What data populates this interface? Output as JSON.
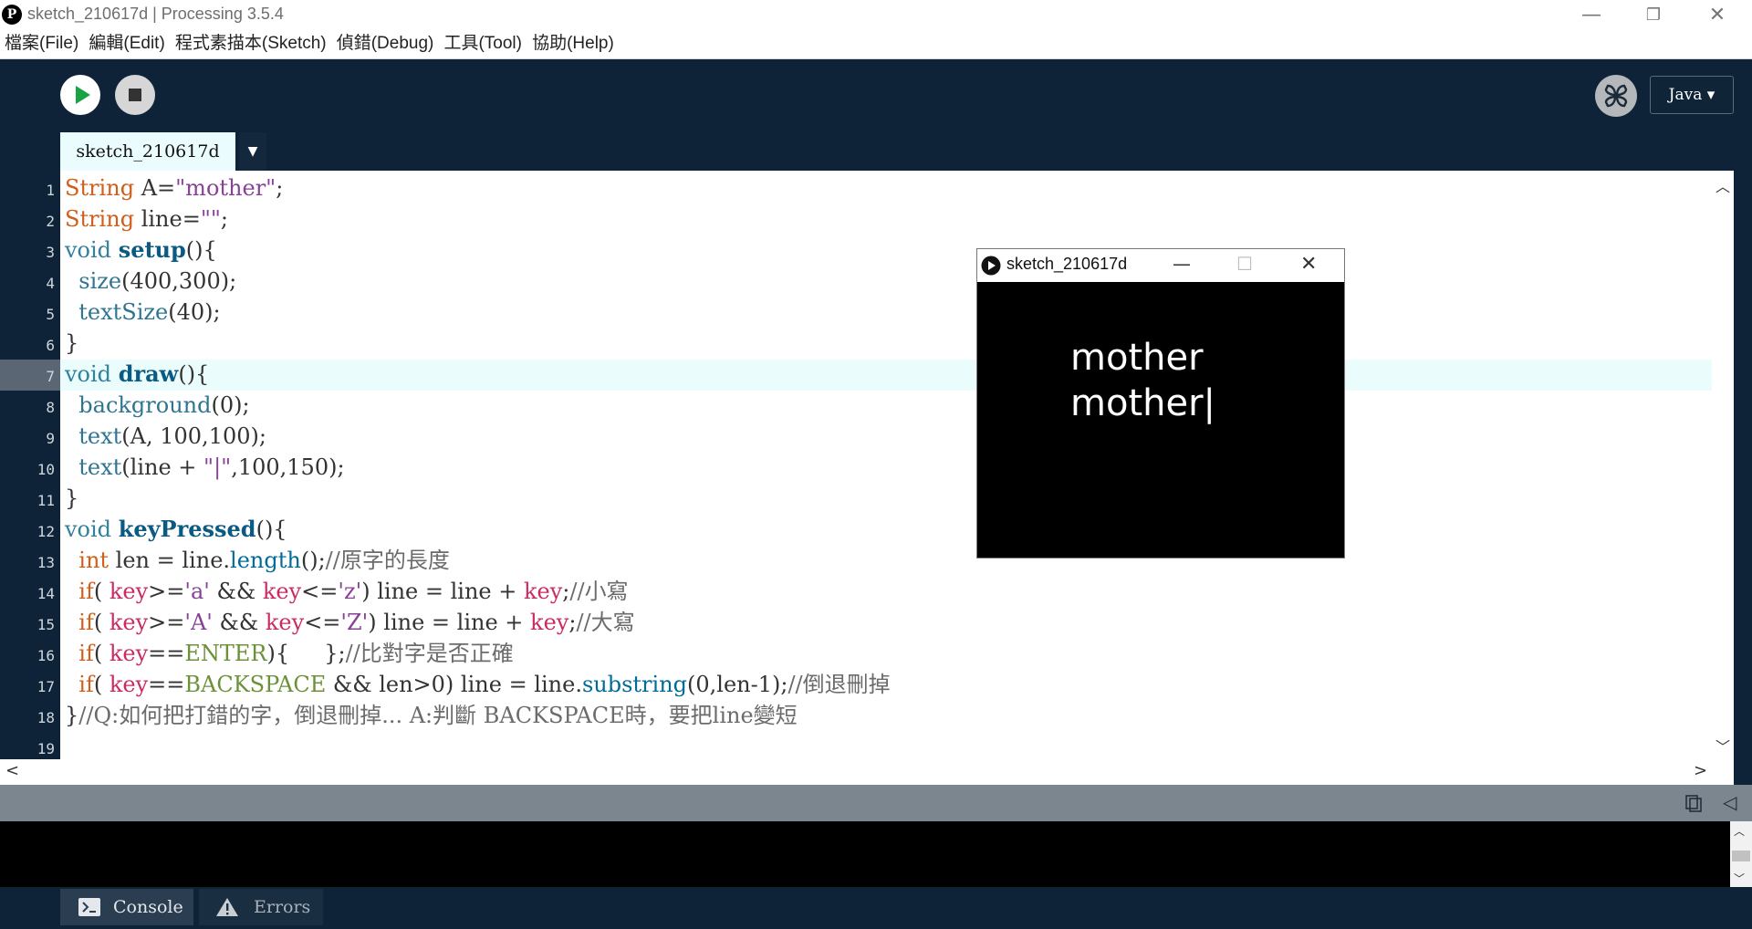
{
  "window": {
    "title": "sketch_210617d | Processing 3.5.4",
    "minimize": "—",
    "maximize": "❐",
    "close": "✕"
  },
  "menu": [
    "檔案(File)",
    "編輯(Edit)",
    "程式素描本(Sketch)",
    "偵錯(Debug)",
    "工具(Tool)",
    "協助(Help)"
  ],
  "toolbar": {
    "mode": "Java ▾"
  },
  "tab": {
    "name": "sketch_210617d",
    "menu_arrow": "▼"
  },
  "editor": {
    "line_numbers": [
      "1",
      "2",
      "3",
      "4",
      "5",
      "6",
      "7",
      "8",
      "9",
      "10",
      "11",
      "12",
      "13",
      "14",
      "15",
      "16",
      "17",
      "18",
      "19"
    ],
    "lines": [
      [
        {
          "t": "String",
          "c": "kw-type"
        },
        {
          "t": " A=",
          "c": ""
        },
        {
          "t": "\"mother\"",
          "c": "kw-str"
        },
        {
          "t": ";",
          "c": ""
        }
      ],
      [
        {
          "t": "String",
          "c": "kw-type"
        },
        {
          "t": " line=",
          "c": ""
        },
        {
          "t": "\"\"",
          "c": "kw-str"
        },
        {
          "t": ";",
          "c": ""
        }
      ],
      [
        {
          "t": "void",
          "c": "kw-void"
        },
        {
          "t": " ",
          "c": ""
        },
        {
          "t": "setup",
          "c": "kw-fn"
        },
        {
          "t": "(){",
          "c": ""
        }
      ],
      [
        {
          "t": "  ",
          "c": ""
        },
        {
          "t": "size",
          "c": "kw-call"
        },
        {
          "t": "(400,300);",
          "c": ""
        }
      ],
      [
        {
          "t": "  ",
          "c": ""
        },
        {
          "t": "textSize",
          "c": "kw-call"
        },
        {
          "t": "(40);",
          "c": ""
        }
      ],
      [
        {
          "t": "}",
          "c": ""
        }
      ],
      [
        {
          "t": "void",
          "c": "kw-void"
        },
        {
          "t": " ",
          "c": ""
        },
        {
          "t": "draw",
          "c": "kw-fn"
        },
        {
          "t": "(){",
          "c": ""
        }
      ],
      [
        {
          "t": "  ",
          "c": ""
        },
        {
          "t": "background",
          "c": "kw-call"
        },
        {
          "t": "(0);",
          "c": ""
        }
      ],
      [
        {
          "t": "  ",
          "c": ""
        },
        {
          "t": "text",
          "c": "kw-call"
        },
        {
          "t": "(A, 100,100);",
          "c": ""
        }
      ],
      [
        {
          "t": "  ",
          "c": ""
        },
        {
          "t": "text",
          "c": "kw-call"
        },
        {
          "t": "(line + ",
          "c": ""
        },
        {
          "t": "\"|\"",
          "c": "kw-str"
        },
        {
          "t": ",100,150);",
          "c": ""
        }
      ],
      [
        {
          "t": "}",
          "c": ""
        }
      ],
      [
        {
          "t": "void",
          "c": "kw-void"
        },
        {
          "t": " ",
          "c": ""
        },
        {
          "t": "keyPressed",
          "c": "kw-fn"
        },
        {
          "t": "(){",
          "c": ""
        }
      ],
      [
        {
          "t": "  ",
          "c": ""
        },
        {
          "t": "int",
          "c": "kw-type"
        },
        {
          "t": " len = line.",
          "c": ""
        },
        {
          "t": "length",
          "c": "kw-method"
        },
        {
          "t": "();",
          "c": ""
        },
        {
          "t": "//原字的長度",
          "c": "comment"
        }
      ],
      [
        {
          "t": "  ",
          "c": ""
        },
        {
          "t": "if",
          "c": "kw-type"
        },
        {
          "t": "( ",
          "c": ""
        },
        {
          "t": "key",
          "c": "kw-key"
        },
        {
          "t": ">=",
          "c": ""
        },
        {
          "t": "'a'",
          "c": "kw-str"
        },
        {
          "t": " && ",
          "c": ""
        },
        {
          "t": "key",
          "c": "kw-key"
        },
        {
          "t": "<=",
          "c": ""
        },
        {
          "t": "'z'",
          "c": "kw-str"
        },
        {
          "t": ") line = line + ",
          "c": ""
        },
        {
          "t": "key",
          "c": "kw-key"
        },
        {
          "t": ";",
          "c": ""
        },
        {
          "t": "//小寫",
          "c": "comment"
        }
      ],
      [
        {
          "t": "  ",
          "c": ""
        },
        {
          "t": "if",
          "c": "kw-type"
        },
        {
          "t": "( ",
          "c": ""
        },
        {
          "t": "key",
          "c": "kw-key"
        },
        {
          "t": ">=",
          "c": ""
        },
        {
          "t": "'A'",
          "c": "kw-str"
        },
        {
          "t": " && ",
          "c": ""
        },
        {
          "t": "key",
          "c": "kw-key"
        },
        {
          "t": "<=",
          "c": ""
        },
        {
          "t": "'Z'",
          "c": "kw-str"
        },
        {
          "t": ") line = line + ",
          "c": ""
        },
        {
          "t": "key",
          "c": "kw-key"
        },
        {
          "t": ";",
          "c": ""
        },
        {
          "t": "//大寫",
          "c": "comment"
        }
      ],
      [
        {
          "t": "  ",
          "c": ""
        },
        {
          "t": "if",
          "c": "kw-type"
        },
        {
          "t": "( ",
          "c": ""
        },
        {
          "t": "key",
          "c": "kw-key"
        },
        {
          "t": "==",
          "c": ""
        },
        {
          "t": "ENTER",
          "c": "kw-const"
        },
        {
          "t": "){     };",
          "c": ""
        },
        {
          "t": "//比對字是否正確",
          "c": "comment"
        }
      ],
      [
        {
          "t": "  ",
          "c": ""
        },
        {
          "t": "if",
          "c": "kw-type"
        },
        {
          "t": "( ",
          "c": ""
        },
        {
          "t": "key",
          "c": "kw-key"
        },
        {
          "t": "==",
          "c": ""
        },
        {
          "t": "BACKSPACE",
          "c": "kw-const"
        },
        {
          "t": " && len>0) line = line.",
          "c": ""
        },
        {
          "t": "substring",
          "c": "kw-method"
        },
        {
          "t": "(0,len-1);",
          "c": ""
        },
        {
          "t": "//倒退刪掉",
          "c": "comment"
        }
      ],
      [
        {
          "t": "}",
          "c": ""
        },
        {
          "t": "//Q:如何把打錯的字，倒退刪掉... A:判斷 BACKSPACE時，要把line變短",
          "c": "comment"
        }
      ],
      []
    ]
  },
  "scroll": {
    "up": "︿",
    "down": "﹀",
    "left": "<",
    "right": ">"
  },
  "console_controls": {
    "collapse": "◁"
  },
  "footer": {
    "console_label": "Console",
    "errors_label": "Errors"
  },
  "sketch": {
    "title": "sketch_210617d",
    "line1": "mother",
    "line2": "mother|",
    "minimize": "—",
    "maximize": "☐",
    "close": "✕"
  }
}
